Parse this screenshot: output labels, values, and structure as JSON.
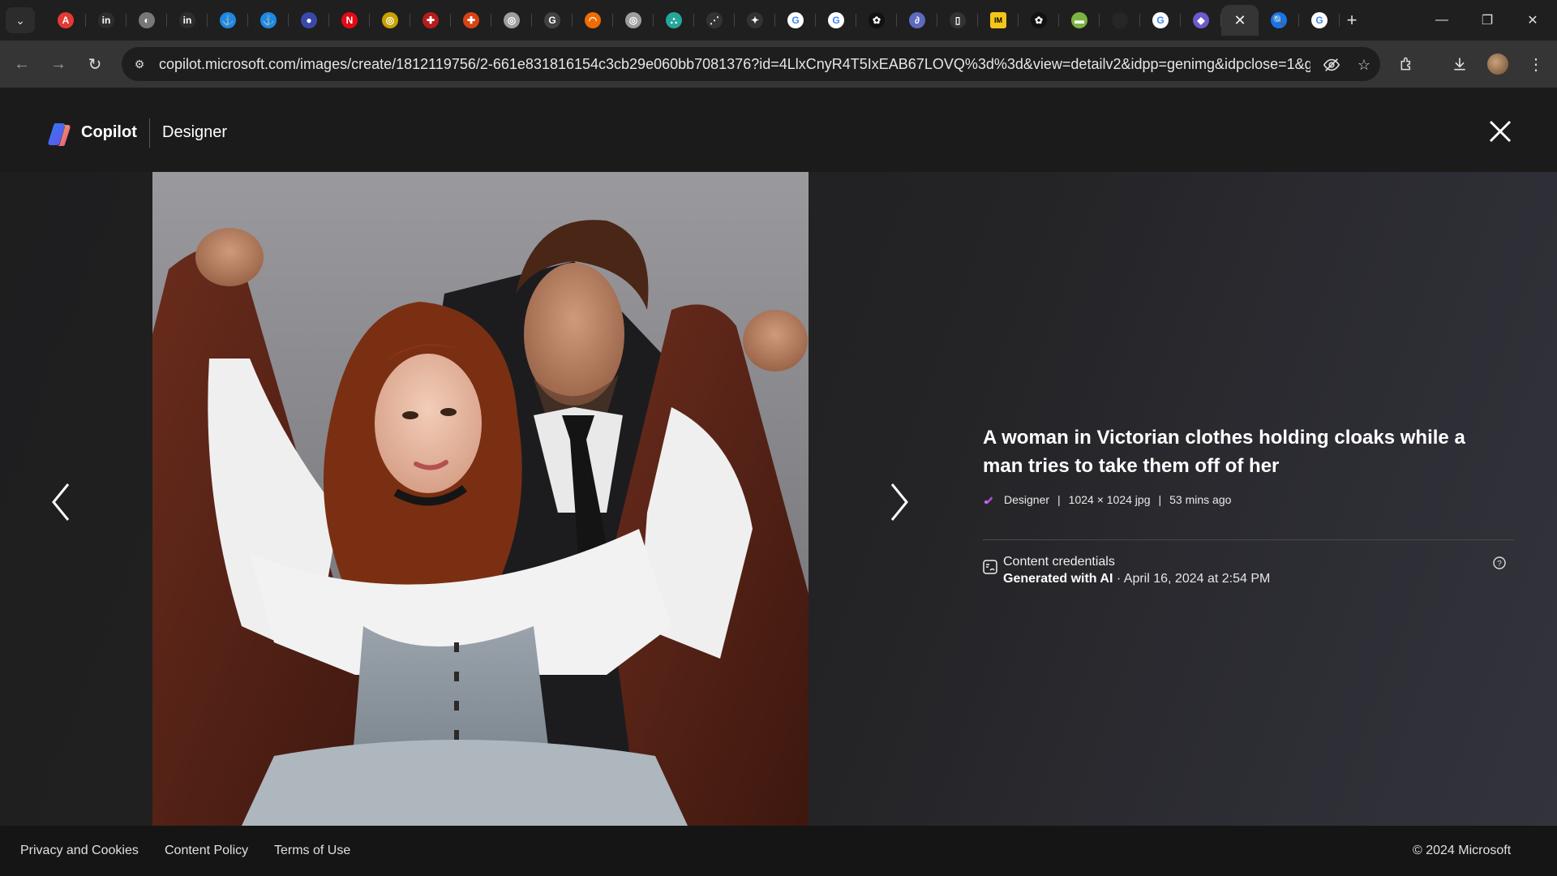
{
  "browser": {
    "tabs": [
      {
        "icon": "adobe-acrobat-icon",
        "color": "#e53935",
        "glyph": "A"
      },
      {
        "icon": "indeed-icon",
        "color": "#2d2d2d",
        "glyph": "in"
      },
      {
        "icon": "globe-icon",
        "color": "#777777",
        "glyph": "◐"
      },
      {
        "icon": "indeed-icon",
        "color": "#2d2d2d",
        "glyph": "in"
      },
      {
        "icon": "anchor-icon",
        "color": "#1e88e5",
        "glyph": "⚓"
      },
      {
        "icon": "anchor-icon",
        "color": "#1e88e5",
        "glyph": "⚓"
      },
      {
        "icon": "circle-icon",
        "color": "#3949ab",
        "glyph": "●"
      },
      {
        "icon": "netflix-icon",
        "color": "#e50914",
        "glyph": "N"
      },
      {
        "icon": "target-icon",
        "color": "#c7a200",
        "glyph": "◎"
      },
      {
        "icon": "shield-crest-icon",
        "color": "#b71c1c",
        "glyph": "✚"
      },
      {
        "icon": "shield-crest-icon",
        "color": "#d84315",
        "glyph": "✚"
      },
      {
        "icon": "spiral-icon",
        "color": "#9e9e9e",
        "glyph": "◎"
      },
      {
        "icon": "g-letter-icon",
        "color": "#424242",
        "glyph": "G"
      },
      {
        "icon": "arc-icon",
        "color": "#ef6c00",
        "glyph": "◠"
      },
      {
        "icon": "spiral-icon",
        "color": "#9e9e9e",
        "glyph": "◎"
      },
      {
        "icon": "org-chart-icon",
        "color": "#26a69a",
        "glyph": "⛬"
      },
      {
        "icon": "dots-icon",
        "color": "#333333",
        "glyph": "⋰"
      },
      {
        "icon": "puzzle-icon",
        "color": "#333333",
        "glyph": "✦"
      },
      {
        "icon": "google-icon",
        "color": "#ffffff",
        "glyph": "G"
      },
      {
        "icon": "google-icon",
        "color": "#ffffff",
        "glyph": "G"
      },
      {
        "icon": "openai-icon",
        "color": "#111111",
        "glyph": "✿"
      },
      {
        "icon": "swirl-icon",
        "color": "#5c6bc0",
        "glyph": "∂"
      },
      {
        "icon": "doc-icon",
        "color": "#333333",
        "glyph": "▯"
      },
      {
        "icon": "imdb-icon",
        "color": "#f5c518",
        "glyph": "IM"
      },
      {
        "icon": "openai-icon",
        "color": "#111111",
        "glyph": "✿"
      },
      {
        "icon": "stripe-icon",
        "color": "#7cb342",
        "glyph": "▬"
      },
      {
        "icon": "blank-icon",
        "color": "#262626",
        "glyph": ""
      },
      {
        "icon": "google-icon",
        "color": "#ffffff",
        "glyph": "G"
      },
      {
        "icon": "copilot-icon",
        "color": "#6a5acd",
        "glyph": "◆"
      }
    ],
    "active_tab_close": "✕",
    "after_tabs": [
      {
        "icon": "search-icon",
        "color": "#1a73e8",
        "glyph": "🔍"
      },
      {
        "icon": "google-icon",
        "color": "#ffffff",
        "glyph": "G"
      }
    ],
    "url": "copilot.microsoft.com/images/create/1812119756/2-661e831816154c3cb29e060bb7081376?id=4LlxCnyR4T5IxEAB67LOVQ%3d%3d&view=detailv2&idpp=genimg&idpclose=1&geni..."
  },
  "header": {
    "brand": "Copilot",
    "product": "Designer"
  },
  "details": {
    "title": "A woman in Victorian clothes holding cloaks while a man tries to take them off of her",
    "meta_source": "Designer",
    "meta_size": "1024 × 1024 jpg",
    "meta_time": "53 mins ago",
    "meta_sep": "|",
    "cred_title": "Content credentials",
    "cred_generated": "Generated with AI",
    "cred_date": " · April 16, 2024 at 2:54 PM"
  },
  "footer": {
    "privacy": "Privacy and Cookies",
    "content_policy": "Content Policy",
    "terms": "Terms of Use",
    "copyright": "© 2024 Microsoft"
  },
  "colors": {
    "page_bg": "#1b1b1b",
    "accent_purple": "#a64ddb"
  }
}
